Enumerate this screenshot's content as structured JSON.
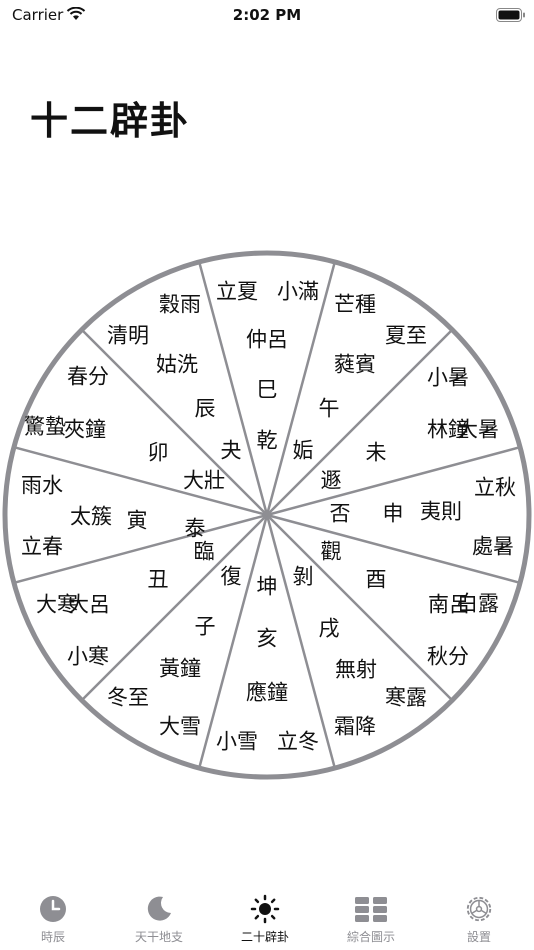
{
  "status": {
    "carrier": "Carrier",
    "time": "2:02 PM"
  },
  "page": {
    "title": "十二辟卦"
  },
  "wheel": {
    "center_labels": [
      "泰",
      "大壯",
      "夬",
      "乾",
      "姤",
      "遯",
      "否",
      "觀",
      "剝",
      "坤",
      "復",
      "臨"
    ],
    "branches": [
      "寅",
      "卯",
      "辰",
      "巳",
      "午",
      "未",
      "申",
      "酉",
      "戌",
      "亥",
      "子",
      "丑"
    ],
    "pitches": [
      "太簇",
      "夾鐘",
      "姑洗",
      "仲呂",
      "蕤賓",
      "林鐘",
      "夷則",
      "南呂",
      "無射",
      "應鐘",
      "黃鐘",
      "大呂"
    ],
    "terms": [
      "雨水",
      "立春",
      "驚蟄",
      "春分",
      "清明",
      "穀雨",
      "立夏",
      "小滿",
      "芒種",
      "夏至",
      "小暑",
      "大暑",
      "立秋",
      "處暑",
      "白露",
      "秋分",
      "寒露",
      "霜降",
      "立冬",
      "小雪",
      "大雪",
      "冬至",
      "小寒",
      "大寒"
    ]
  },
  "tabs": [
    {
      "label": "時辰",
      "icon": "clock-icon"
    },
    {
      "label": "天干地支",
      "icon": "moon-icon"
    },
    {
      "label": "二十辟卦",
      "icon": "sun-icon",
      "active": true
    },
    {
      "label": "綜合圖示",
      "icon": "grid-icon"
    },
    {
      "label": "設置",
      "icon": "gear-icon"
    }
  ]
}
